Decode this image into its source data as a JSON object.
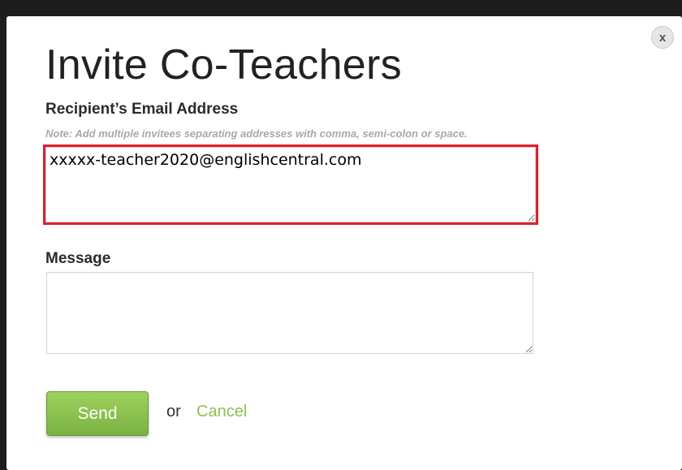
{
  "dialog": {
    "title": "Invite Co-Teachers",
    "close_label": "x"
  },
  "recipient": {
    "label": "Recipient’s Email Address",
    "note": "Note: Add multiple invitees separating addresses with comma, semi-colon or space.",
    "value": "xxxxx-teacher2020@englishcentral.com"
  },
  "message": {
    "label": "Message",
    "value": ""
  },
  "actions": {
    "send_label": "Send",
    "or_text": "or",
    "cancel_label": "Cancel"
  },
  "colors": {
    "send_button": "#8cc152",
    "cancel_link": "#8cc152",
    "highlight_border": "#e0202b"
  }
}
